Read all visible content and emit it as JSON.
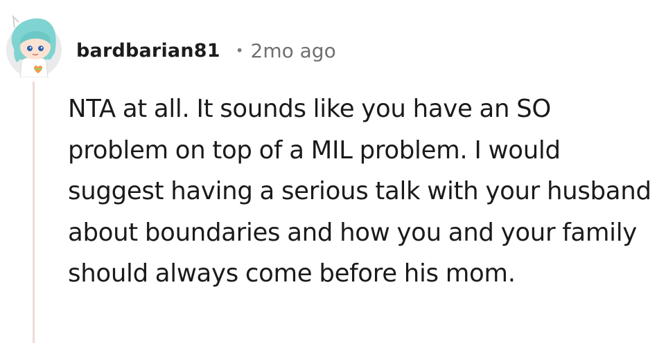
{
  "comment": {
    "username": "bardbarian81",
    "separator": "•",
    "timestamp": "2mo ago",
    "body": "NTA at all. It sounds like you have an SO problem on top of a MIL problem. I would suggest having a serious talk with your husband about boundaries and how you and your family should always come before his mom."
  },
  "avatar": {
    "icon": "snoo-avatar-icon",
    "hair_color": "#7fd3d0",
    "background_color": "#e9ebec"
  },
  "colors": {
    "thread_line": "#e9dcd8",
    "username": "#1c1c1c",
    "timestamp": "#6f6f6f",
    "body": "#1a1a1b"
  }
}
